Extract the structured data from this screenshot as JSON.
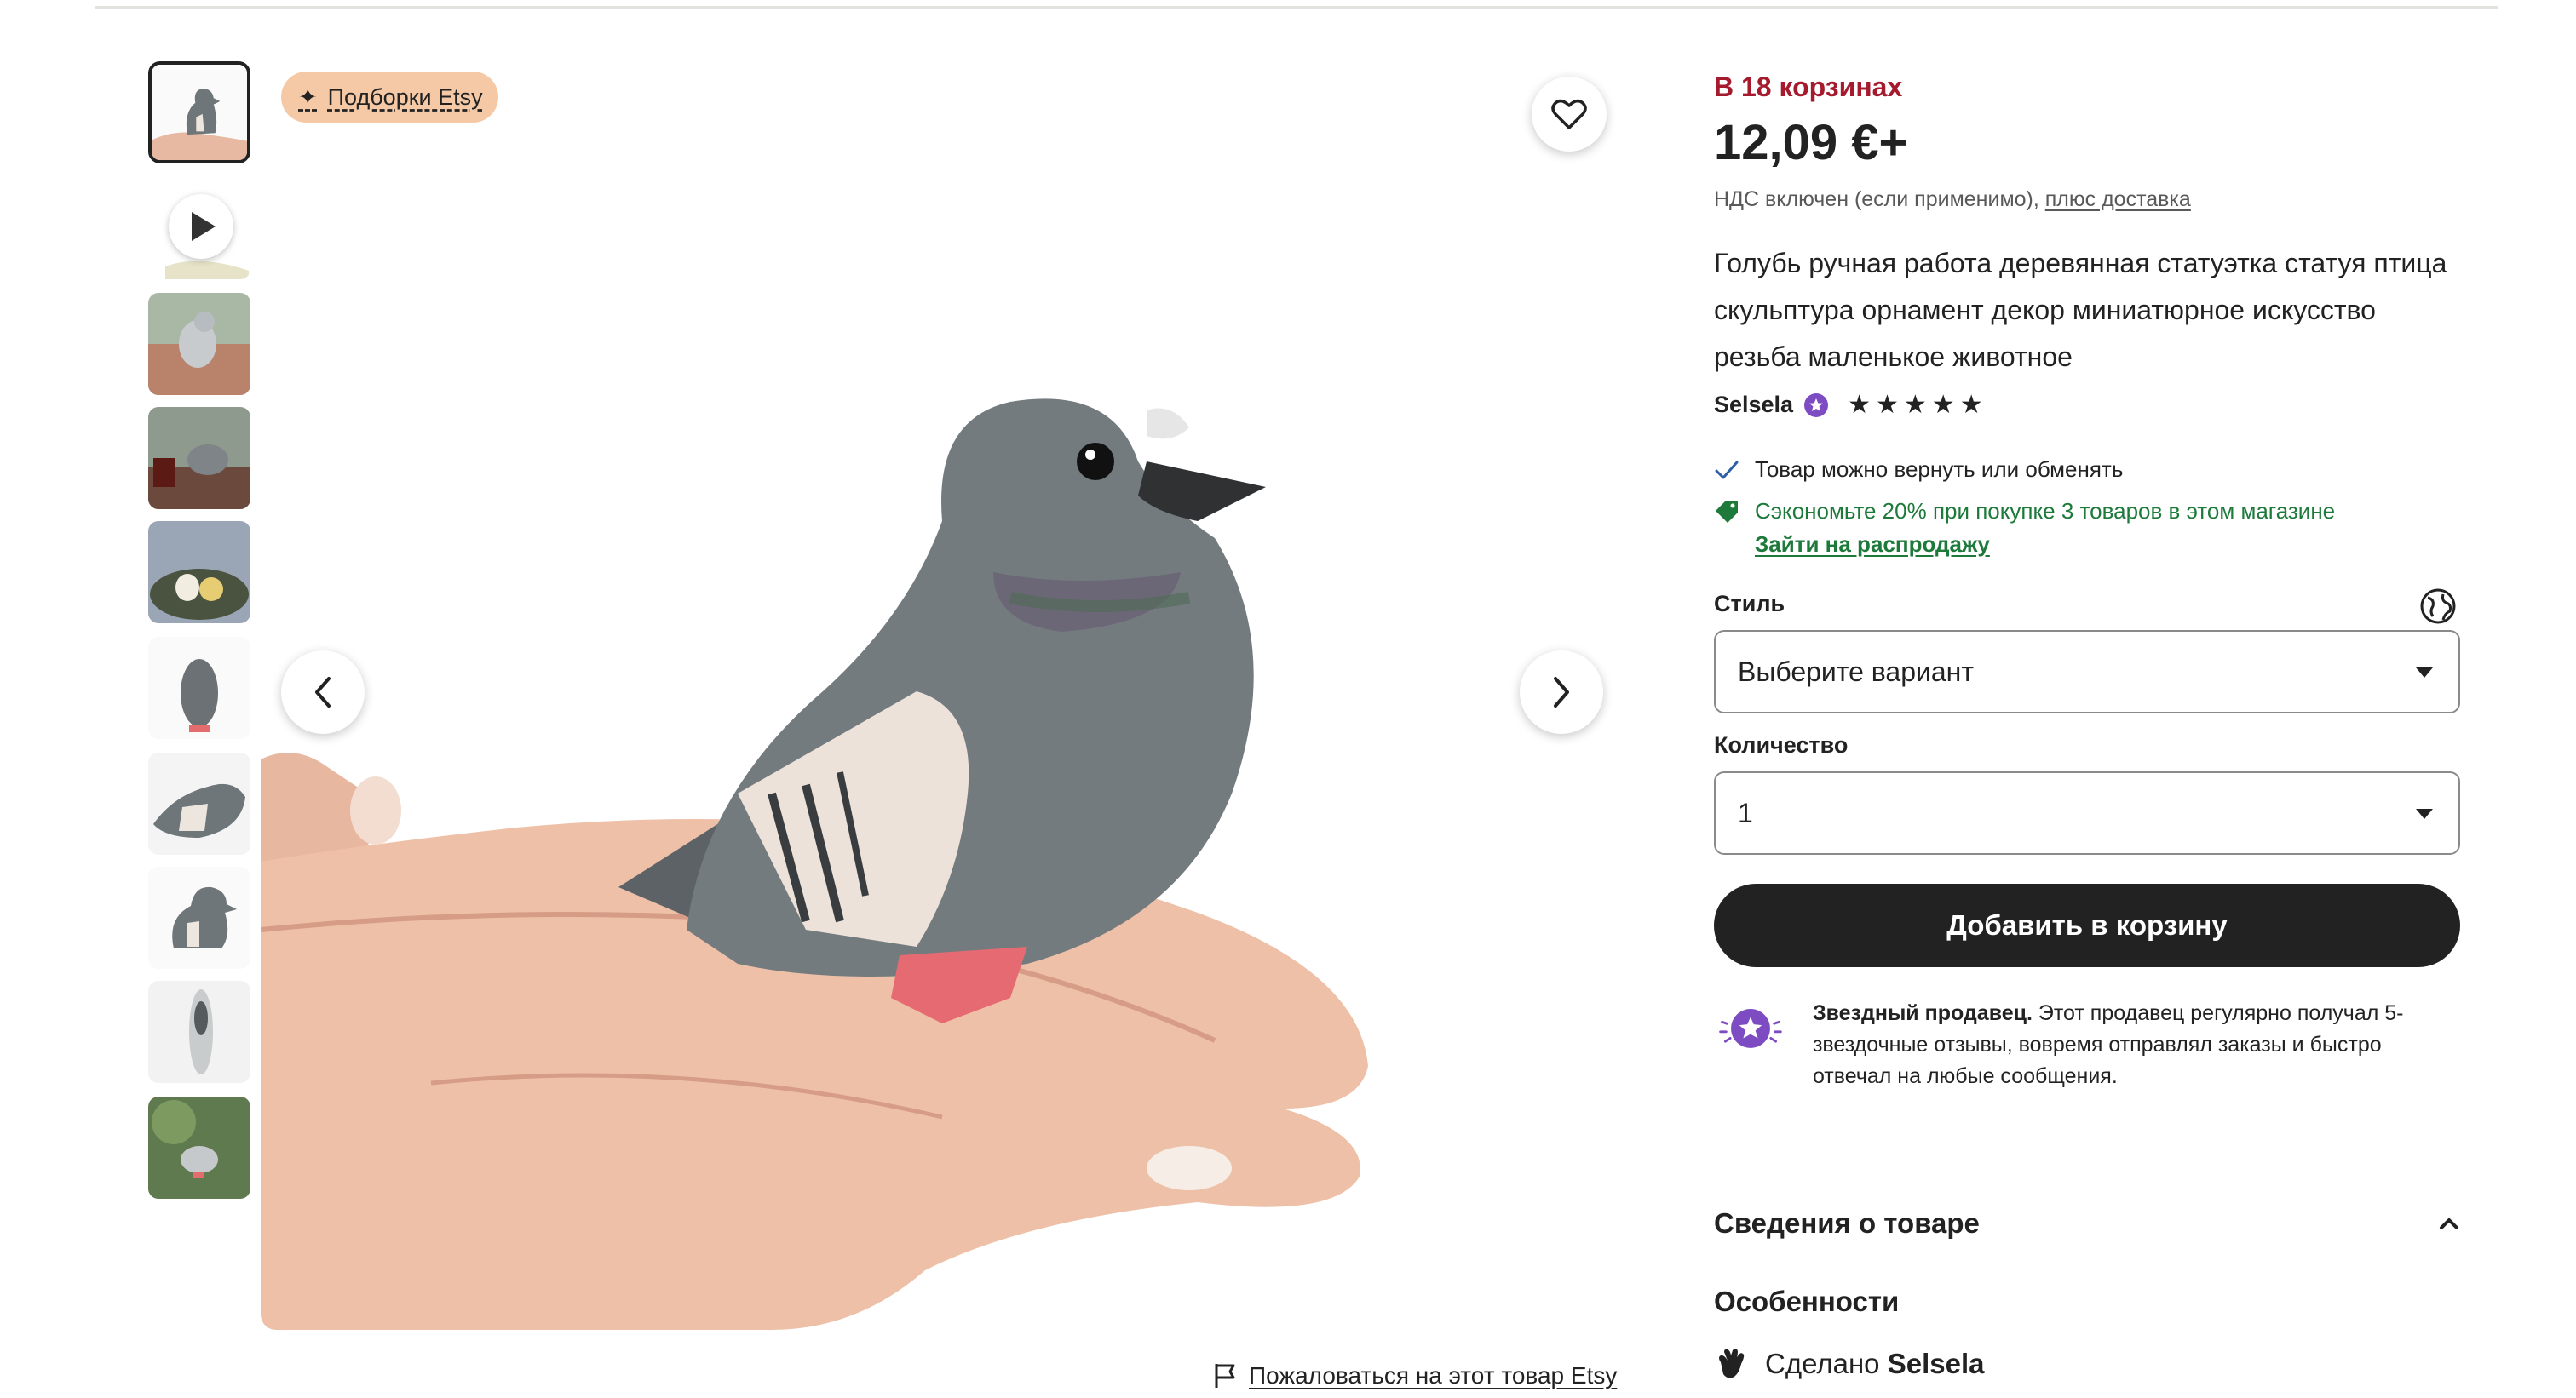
{
  "gallery": {
    "badge_label": "Подборки Etsy",
    "report_label": "Пожаловаться на этот товар Etsy",
    "thumbnails": [
      {
        "kind": "photo",
        "active": true
      },
      {
        "kind": "video",
        "active": false
      },
      {
        "kind": "photo",
        "active": false
      },
      {
        "kind": "photo",
        "active": false
      },
      {
        "kind": "photo",
        "active": false
      },
      {
        "kind": "photo",
        "active": false
      },
      {
        "kind": "photo",
        "active": false
      },
      {
        "kind": "photo",
        "active": false
      },
      {
        "kind": "photo",
        "active": false
      },
      {
        "kind": "photo",
        "active": false
      }
    ]
  },
  "product": {
    "in_carts": "В 18 корзинах",
    "price": "12,09 €+",
    "vat_text": "НДС включен (если применимо),",
    "vat_link": "плюс доставка",
    "title": "Голубь ручная работа деревянная статуэтка статуя птица скульптура орнамент декор миниатюрное искусство резьба маленькое животное",
    "seller": "Selsela",
    "rating": 5
  },
  "benefits": {
    "returns": "Товар можно вернуть или обменять",
    "discount": "Сэкономьте 20% при покупке 3 товаров в этом магазине",
    "sale_link": "Зайти на распродажу"
  },
  "options": {
    "style_label": "Стиль",
    "style_value": "Выберите вариант",
    "qty_label": "Количество",
    "qty_value": "1"
  },
  "cart": {
    "add_label": "Добавить в корзину"
  },
  "star_seller": {
    "title": "Звездный продавец.",
    "text": "Этот продавец регулярно получал 5-звездочные отзывы, вовремя отправлял заказы и быстро отвечал на любые сообщения."
  },
  "details": {
    "heading": "Сведения о товаре",
    "features": "Особенности",
    "made_by_prefix": "Сделано",
    "made_by_name": "Selsela"
  },
  "colors": {
    "accent_red": "#a61a2e",
    "accent_green": "#1d7a3a",
    "button_dark": "#222222",
    "badge_bg": "#f5c8a6",
    "star_seller_purple": "#7d4cc2"
  }
}
